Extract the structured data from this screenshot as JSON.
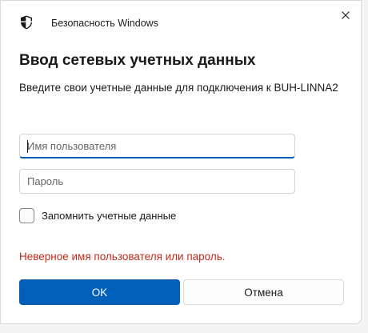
{
  "titlebar": {
    "app_title": "Безопасность Windows",
    "icon": "shield-icon",
    "close_icon": "close-icon"
  },
  "dialog": {
    "heading": "Ввод сетевых учетных данных",
    "description": "Введите свои учетные данные для подключения к BUH-LINNA2",
    "username": {
      "placeholder": "Имя пользователя",
      "value": ""
    },
    "password": {
      "placeholder": "Пароль",
      "value": ""
    },
    "remember": {
      "label": "Запомнить учетные данные",
      "checked": false
    },
    "error": "Неверное имя пользователя или пароль.",
    "ok_label": "OK",
    "cancel_label": "Отмена"
  },
  "colors": {
    "accent": "#005fb8",
    "error": "#c42b1c"
  }
}
